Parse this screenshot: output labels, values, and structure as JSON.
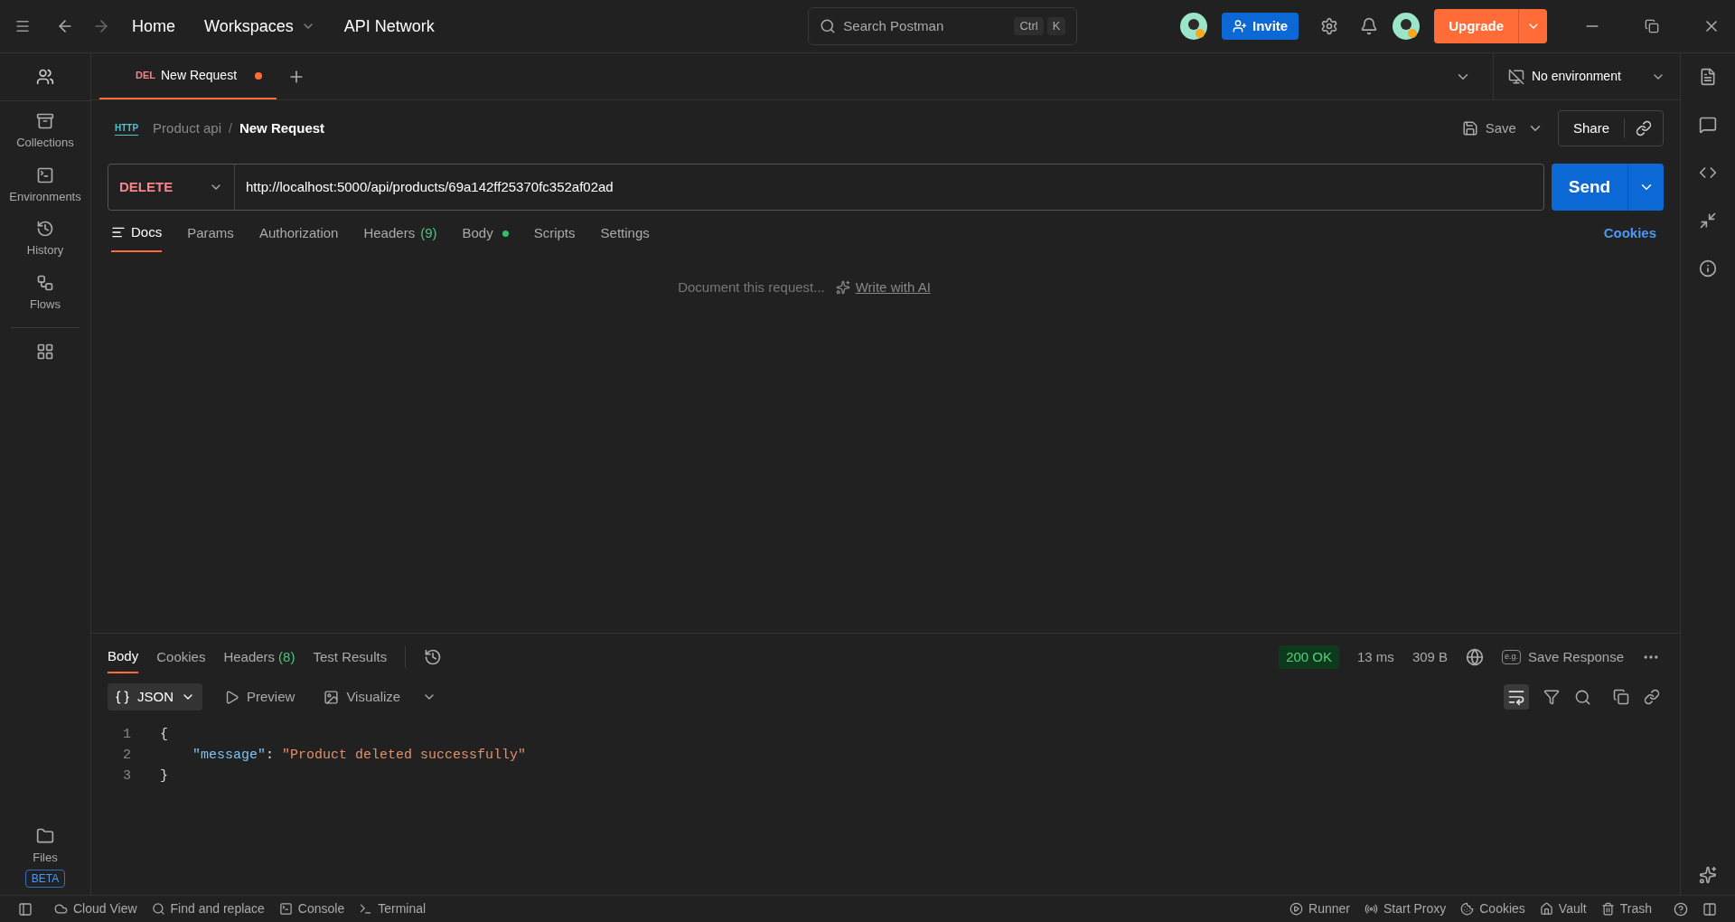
{
  "title_bar": {
    "nav": [
      "Home",
      "Workspaces",
      "API Network"
    ],
    "search": {
      "placeholder": "Search Postman",
      "shortcut": [
        "Ctrl",
        "K"
      ]
    },
    "invite": "Invite",
    "upgrade": "Upgrade"
  },
  "sidebar": {
    "items": [
      {
        "label": "Collections"
      },
      {
        "label": "Environments"
      },
      {
        "label": "History"
      },
      {
        "label": "Flows"
      }
    ],
    "files": {
      "label": "Files",
      "badge": "BETA"
    }
  },
  "tabs": [
    {
      "method": "DEL",
      "label": "New Request",
      "selected": true,
      "unsaved": true
    }
  ],
  "environment": "No environment",
  "breadcrumb": {
    "badge": "HTTP",
    "collection": "Product api",
    "separator": "/",
    "request": "New Request"
  },
  "actions": {
    "save": "Save",
    "share": "Share"
  },
  "request": {
    "method": "DELETE",
    "url": "http://localhost:5000/api/products/69a142ff25370fc352af02ad",
    "send": "Send"
  },
  "request_tabs": [
    {
      "label": "Docs",
      "selected": true
    },
    {
      "label": "Params",
      "selected": false
    },
    {
      "label": "Authorization",
      "selected": false
    },
    {
      "label": "Headers",
      "count": "(9)",
      "selected": false
    },
    {
      "label": "Body",
      "dot": true,
      "selected": false
    },
    {
      "label": "Scripts",
      "selected": false
    },
    {
      "label": "Settings",
      "selected": false
    }
  ],
  "cookies_link": "Cookies",
  "docs": {
    "placeholder": "Document this request...",
    "ai_link": "Write with AI"
  },
  "response_tabs": [
    {
      "label": "Body",
      "selected": true
    },
    {
      "label": "Cookies",
      "selected": false
    },
    {
      "label": "Headers",
      "count": "(8)",
      "selected": false
    },
    {
      "label": "Test Results",
      "selected": false
    }
  ],
  "response_meta": {
    "status": "200 OK",
    "time": "13 ms",
    "size": "309 B",
    "save_badge": "e.g.",
    "save": "Save Response"
  },
  "view_modes": [
    {
      "label": "JSON",
      "selected": true
    },
    {
      "label": "Preview",
      "selected": false
    },
    {
      "label": "Visualize",
      "selected": false
    }
  ],
  "code_lines": [
    {
      "number": "1",
      "text": "{"
    },
    {
      "number": "2",
      "key": "\"message\"",
      "sep": ": ",
      "value": "\"Product deleted successfully\""
    },
    {
      "number": "3",
      "text": "}"
    }
  ],
  "status_bar": {
    "left": [
      "Cloud View",
      "Find and replace",
      "Console",
      "Terminal"
    ],
    "right": [
      "Runner",
      "Start Proxy",
      "Cookies",
      "Vault",
      "Trash"
    ]
  }
}
